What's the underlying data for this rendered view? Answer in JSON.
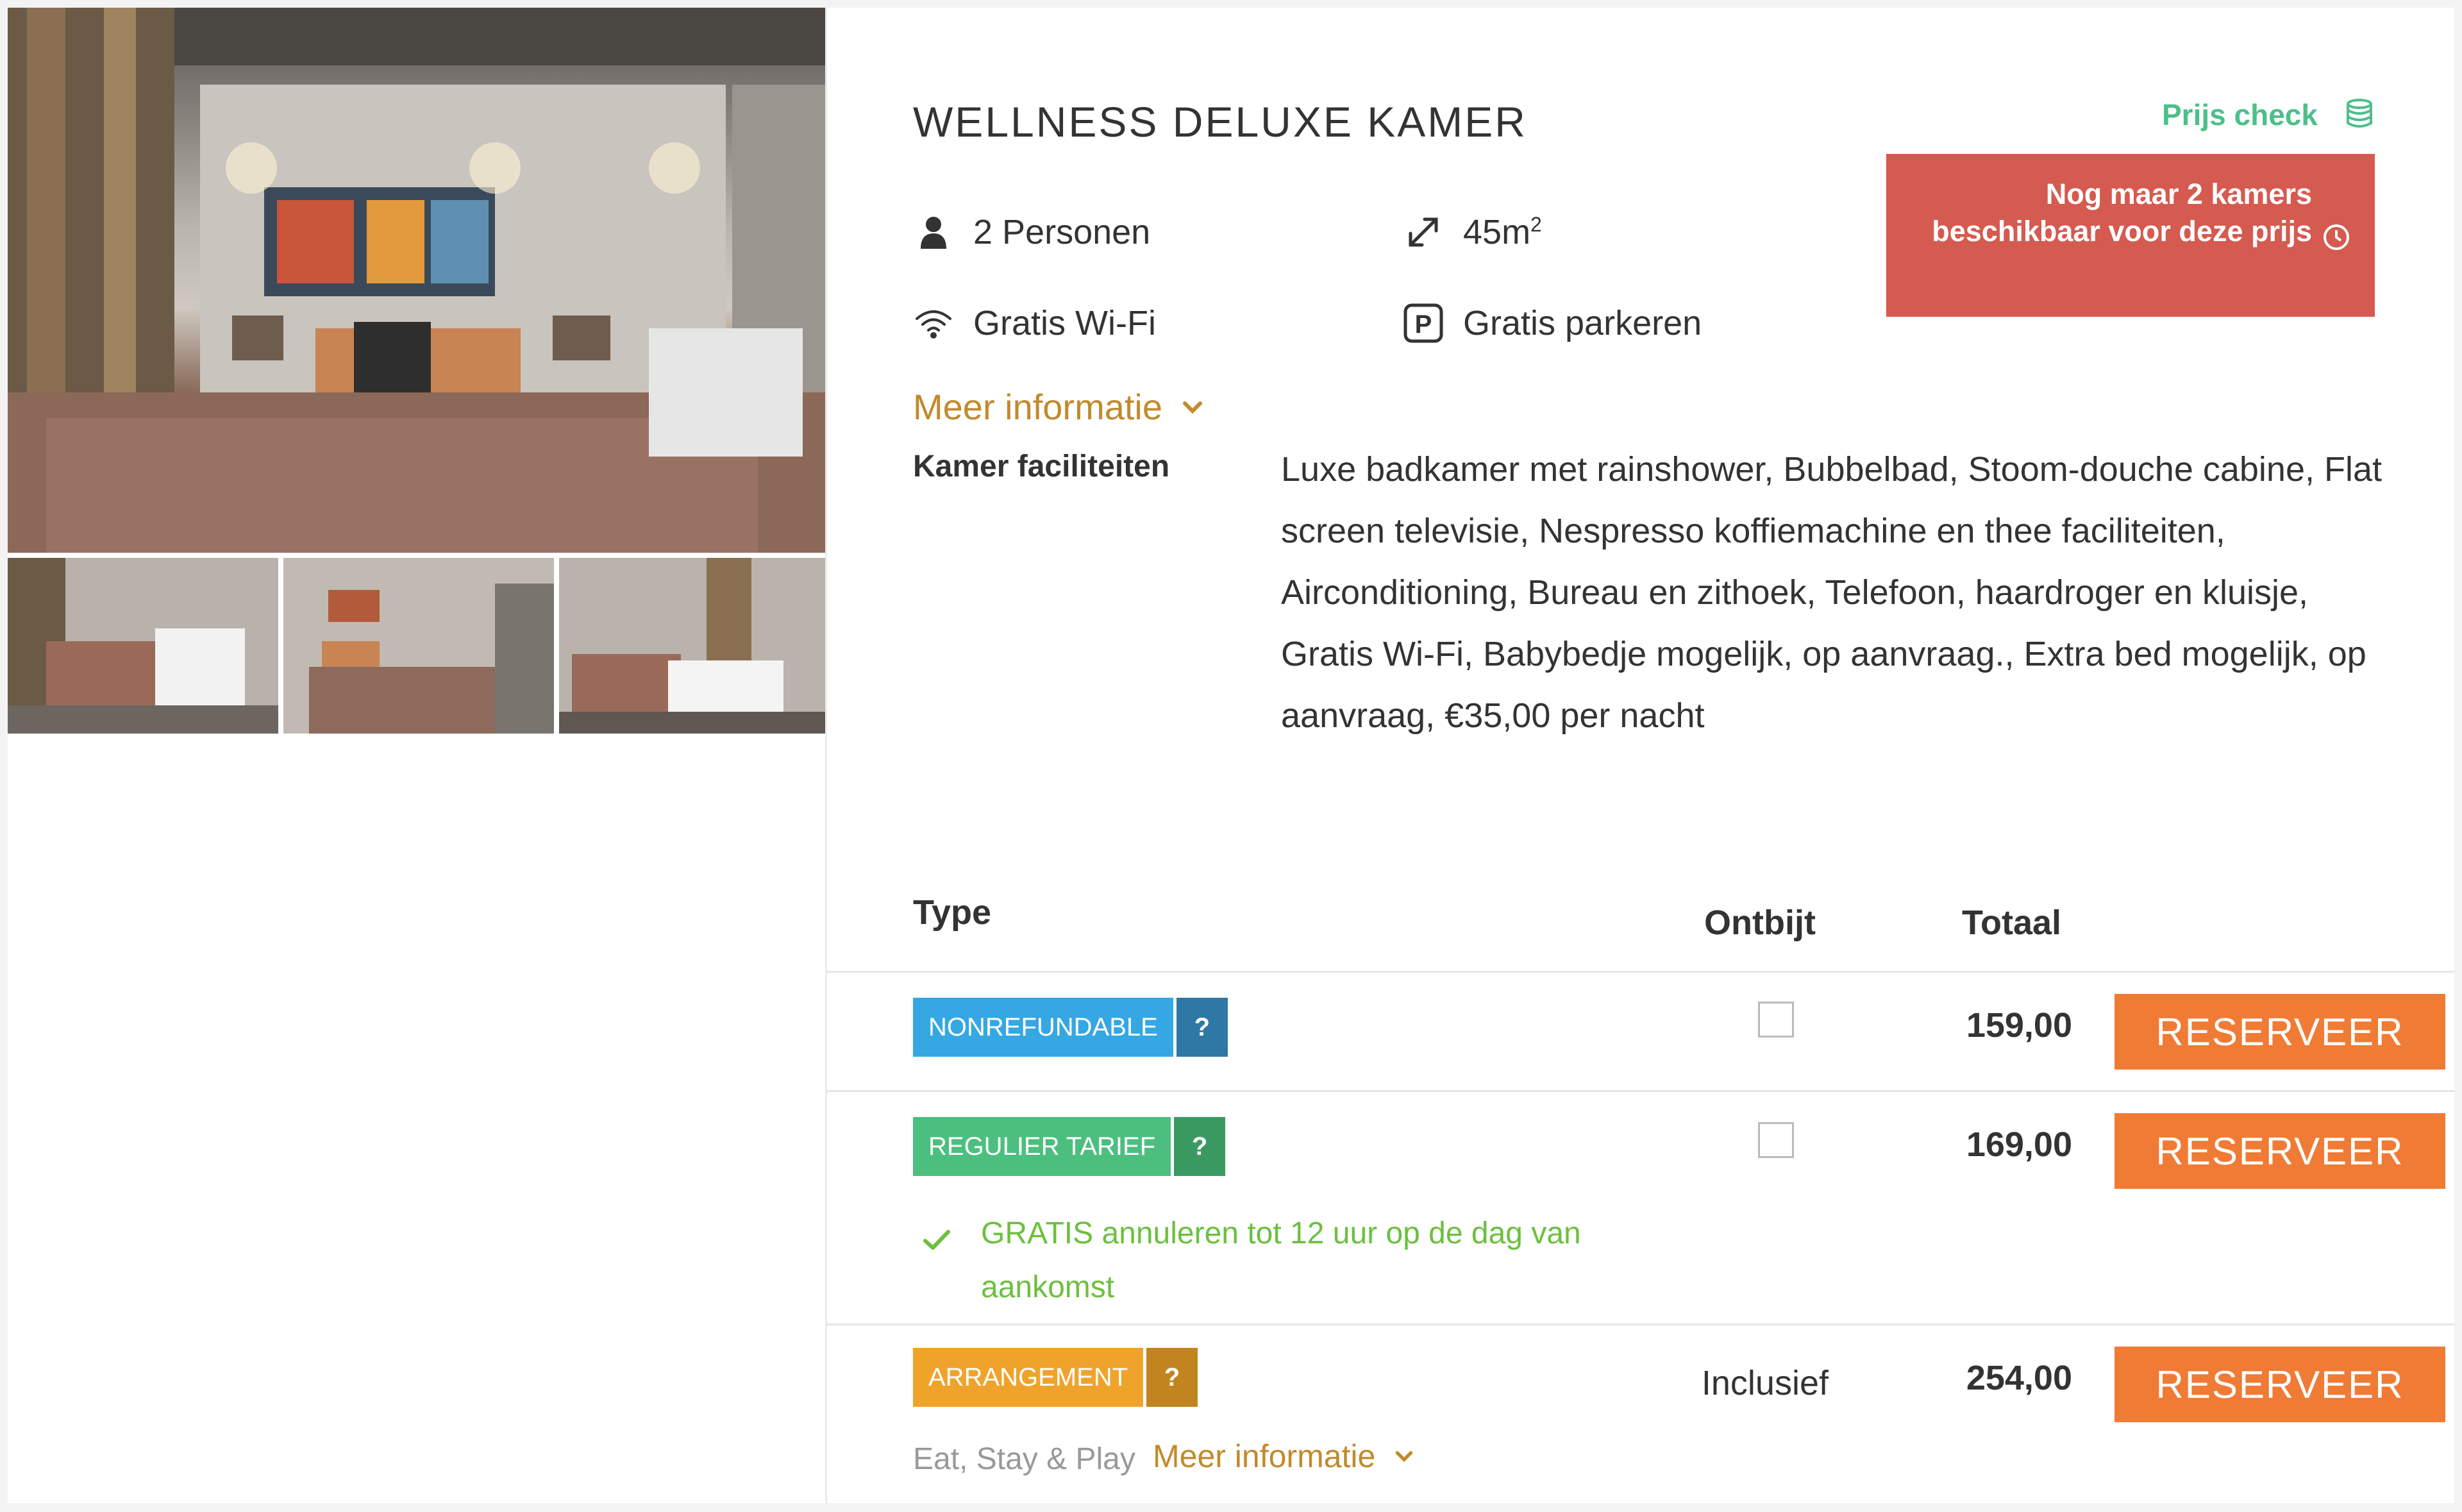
{
  "room": {
    "title": "WELLNESS DELUXE KAMER",
    "features": {
      "persons": "2 Personen",
      "size_value": "45m",
      "size_sup": "2",
      "wifi": "Gratis Wi-Fi",
      "parking": "Gratis parkeren"
    },
    "more_info": "Meer informatie",
    "facilities_label": "Kamer faciliteiten",
    "facilities_text": "Luxe badkamer met rainshower, Bubbelbad, Stoom-douche cabine, Flat screen televisie, Nespresso koffiemachine en thee faciliteiten, Airconditioning, Bureau en zithoek, Telefoon, haardroger en kluisje, Gratis Wi-Fi, Babybedje mogelijk, op aanvraag., Extra bed mogelijk, op aanvraag, €35,00 per nacht"
  },
  "price_check": {
    "label": "Prijs check"
  },
  "availability": {
    "text": "Nog maar 2 kamers beschikbaar voor deze prijs"
  },
  "table": {
    "headers": {
      "type": "Type",
      "breakfast": "Ontbijt",
      "total": "Totaal"
    },
    "rows": [
      {
        "badge": "NONREFUNDABLE",
        "badge_color": "#35a7e3",
        "q": "?",
        "q_color": "#2e78a6",
        "price": "159,00",
        "button": "RESERVEER"
      },
      {
        "badge": "REGULIER TARIEF",
        "badge_color": "#4cbf7f",
        "q": "?",
        "q_color": "#3a9a62",
        "price": "169,00",
        "button": "RESERVEER",
        "note": "GRATIS annuleren tot 12 uur op de dag van aankomst"
      },
      {
        "badge": "ARRANGEMENT",
        "badge_color": "#f0a32a",
        "q": "?",
        "q_color": "#c2841f",
        "breakfast": "Inclusief",
        "price": "254,00",
        "button": "RESERVEER",
        "package_name": "Eat, Stay & Play",
        "more_info": "Meer informatie"
      }
    ]
  },
  "colors": {
    "accent_orange": "#f07b35",
    "alert_red": "#d55a50",
    "gold": "#c28a2c",
    "green": "#4cbf8a"
  }
}
